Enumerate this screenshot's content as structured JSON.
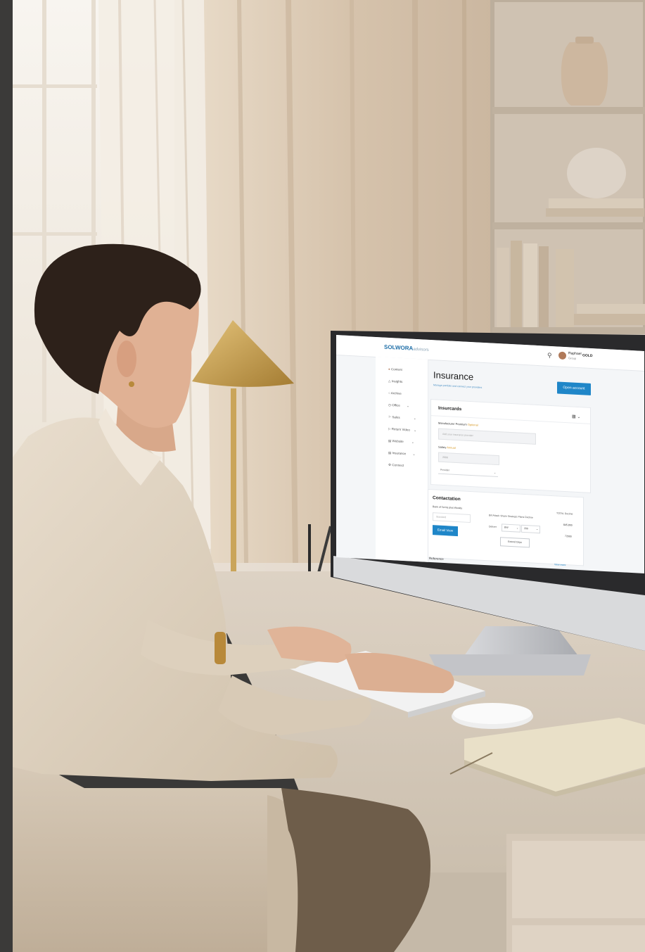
{
  "screen": {
    "brand": {
      "name": "SOLWORA",
      "tail": "advisors"
    },
    "user": {
      "name": "Raphael",
      "role": "Group",
      "badge": "GOLD"
    },
    "sidebar": {
      "items": [
        {
          "label": "Content"
        },
        {
          "label": "Insights"
        },
        {
          "label": "Archive"
        },
        {
          "label": "Office"
        },
        {
          "label": "Sales"
        },
        {
          "label": "Return Video"
        },
        {
          "label": "Website"
        },
        {
          "label": "Insurance"
        },
        {
          "label": "Connect"
        }
      ]
    },
    "page": {
      "title": "Insurance",
      "subtitle": "Manage portfolio and connect your providers",
      "primary_button": "Open account"
    },
    "card1": {
      "title": "Insurcards",
      "field1_label": "Manufacturer Premium",
      "field1_badge": "Optional",
      "field1_placeholder": "Add your insurance provider",
      "field2_label": "Salary",
      "field2_badge": "Annual",
      "field2_value": "2000",
      "field3_value": "Provider"
    },
    "card2": {
      "title": "Contactation",
      "field_label": "Bank of Terms plus Weekly",
      "field_placeholder": "Standard",
      "link_text": "Bill Attach Share Strategic Plans Decline",
      "select_label": "Deliver",
      "select1": "BW",
      "select2": "200",
      "right_header": "TOTAL Decline",
      "right_value1": "$45,800",
      "right_value2": "72000",
      "button": "Email View",
      "secondary_button": "Extend Days"
    },
    "section3": {
      "title": "Reference",
      "link": "View more"
    }
  }
}
